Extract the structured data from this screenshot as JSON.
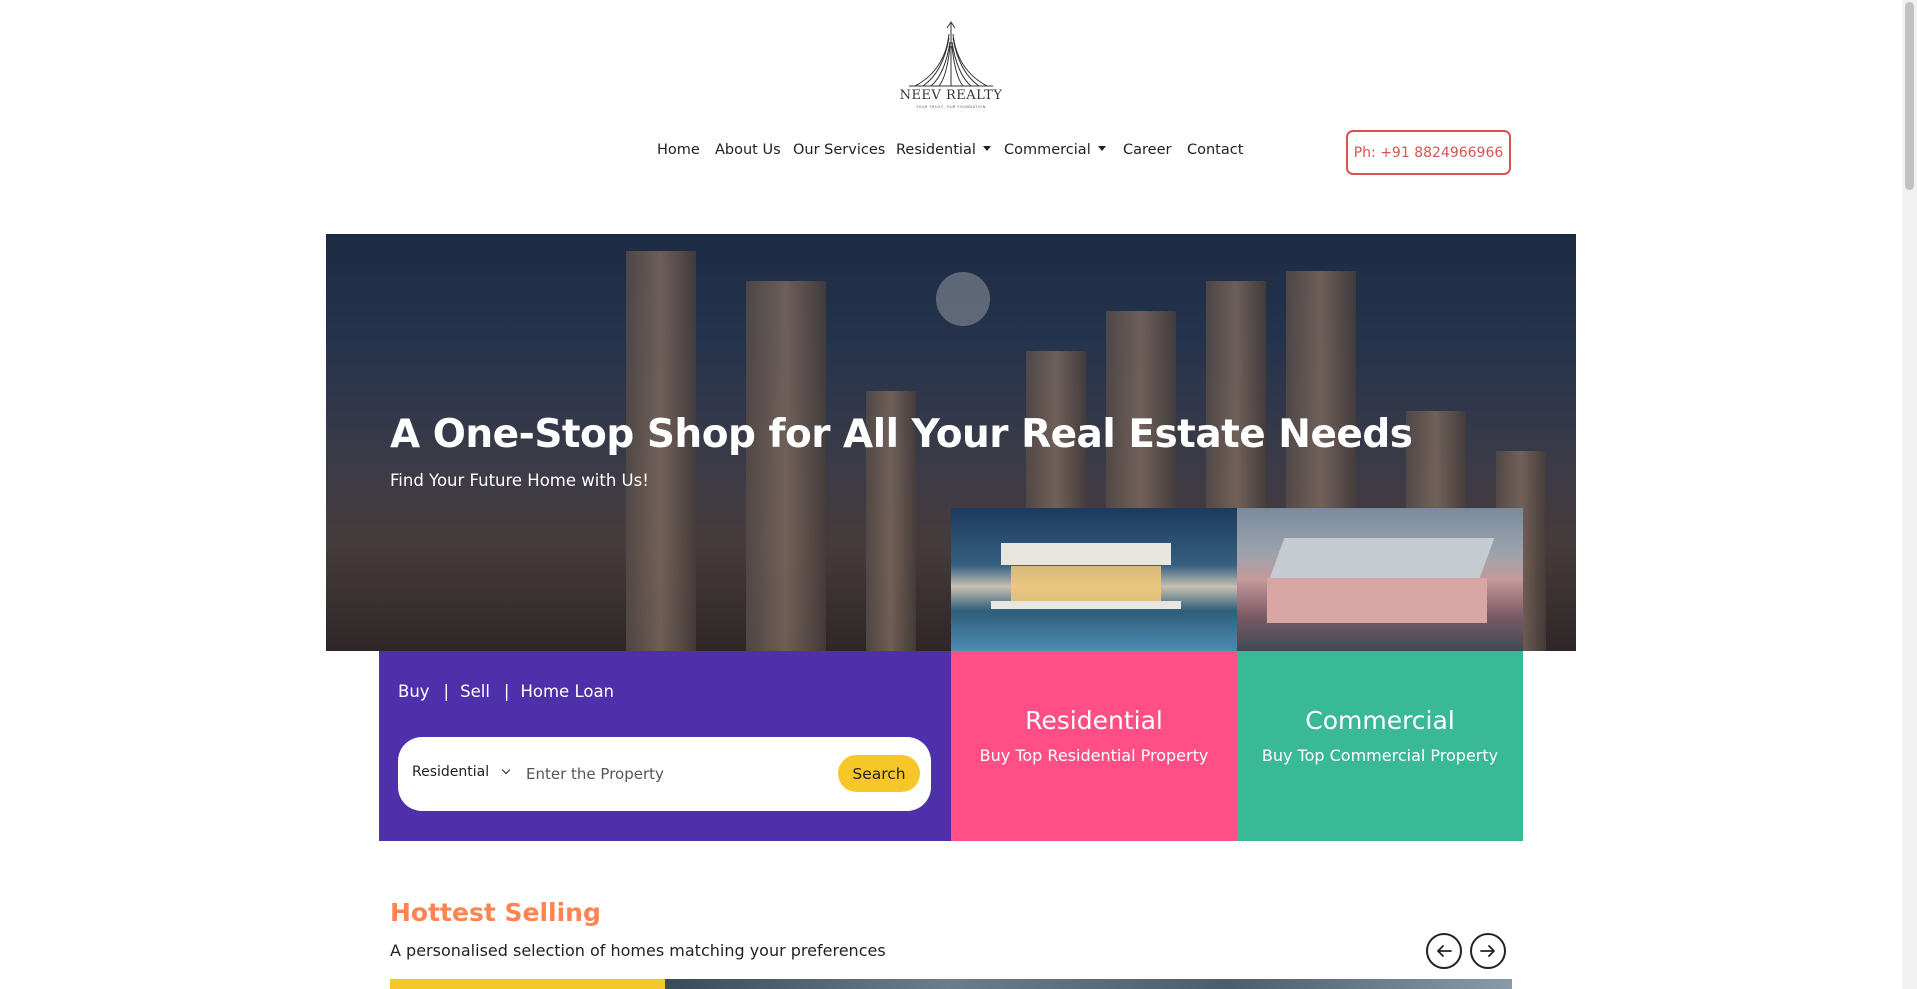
{
  "brand": {
    "name": "NEEV REALTY",
    "tagline": "YOUR TRUST, OUR FOUNDATION",
    "logo_icon": "skyscraper-logo-icon"
  },
  "nav": {
    "items": [
      {
        "label": "Home"
      },
      {
        "label": "About Us"
      },
      {
        "label": "Our Services"
      },
      {
        "label": "Residential",
        "has_dropdown": true
      },
      {
        "label": "Commercial",
        "has_dropdown": true
      },
      {
        "label": "Career"
      },
      {
        "label": "Contact"
      }
    ],
    "phone_label": "Ph: +91 8824966966"
  },
  "hero": {
    "title": "A One-Stop Shop for All Your Real Estate Needs",
    "subtitle": "Find Your Future Home with Us!"
  },
  "search": {
    "tabs": [
      "Buy",
      "Sell",
      "Home Loan"
    ],
    "separator": "|",
    "category_selected": "Residential",
    "input_placeholder": "Enter the Property",
    "button_label": "Search"
  },
  "tiles": {
    "residential": {
      "title": "Residential",
      "subtitle": "Buy Top Residential Property"
    },
    "commercial": {
      "title": "Commercial",
      "subtitle": "Buy Top Commercial Property"
    }
  },
  "hottest": {
    "title": "Hottest Selling",
    "subtitle": "A personalised selection of homes matching your preferences",
    "prev_icon": "arrow-left-icon",
    "next_icon": "arrow-right-icon"
  },
  "colors": {
    "search_panel": "#4e31aa",
    "residential_tile": "#ff4f86",
    "commercial_tile": "#39b996",
    "search_button": "#f7c72a",
    "phone_accent": "#d9534f",
    "section_title": "#ff8450"
  }
}
